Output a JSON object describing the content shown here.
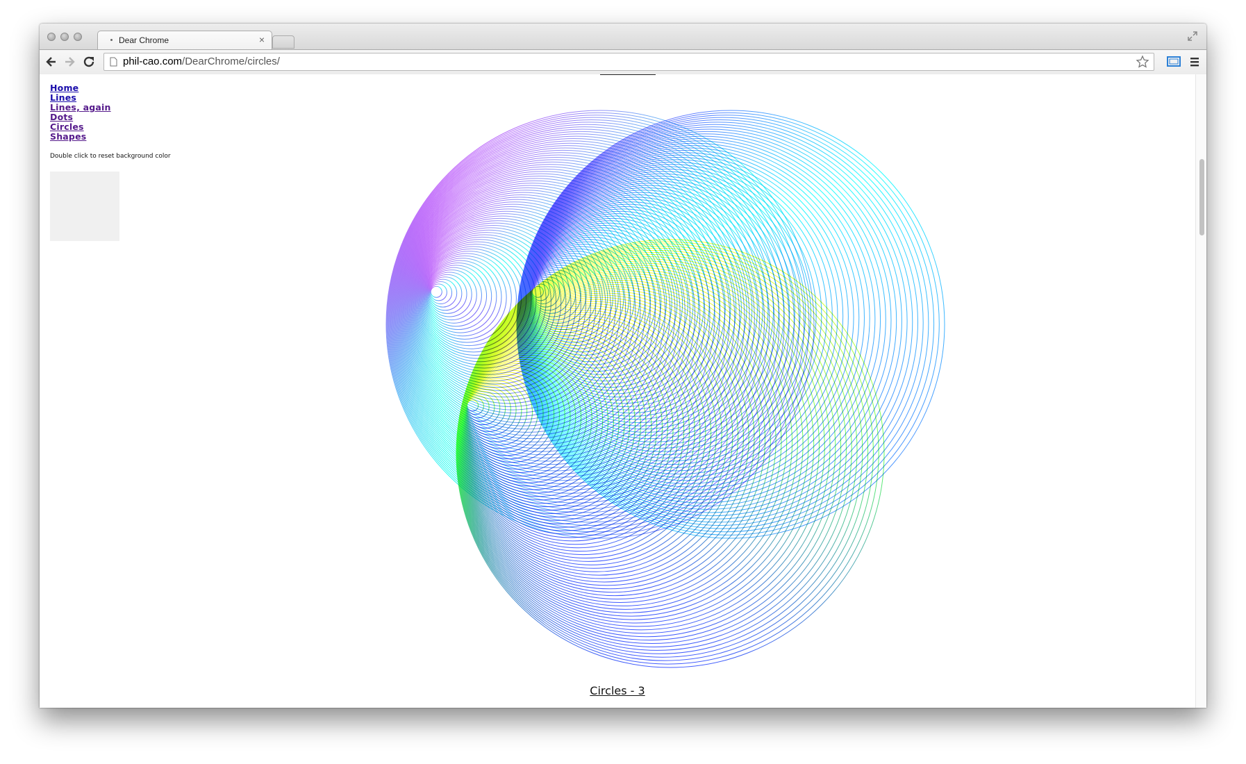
{
  "browser": {
    "tab_title": "Dear Chrome",
    "url_host": "phil-cao.com",
    "url_path": "/DearChrome/circles/"
  },
  "nav": {
    "links": [
      "Home",
      "Lines",
      "Lines, again",
      "Dots",
      "Circles",
      "Shapes"
    ]
  },
  "hint": "Double click to reset background color",
  "artwork": {
    "circles": [
      {
        "name": "magenta-cyan-circle",
        "colors": [
          "#ff00ff",
          "#00ffee",
          "#8800ff"
        ]
      },
      {
        "name": "violet-cyan-circle",
        "colors": [
          "#7a00ff",
          "#00ffff",
          "#3a4dff"
        ]
      },
      {
        "name": "yellow-green-blue-circle",
        "colors": [
          "#ffff00",
          "#44ff44",
          "#1f3dff"
        ]
      }
    ]
  },
  "caption": "Circles - 3"
}
